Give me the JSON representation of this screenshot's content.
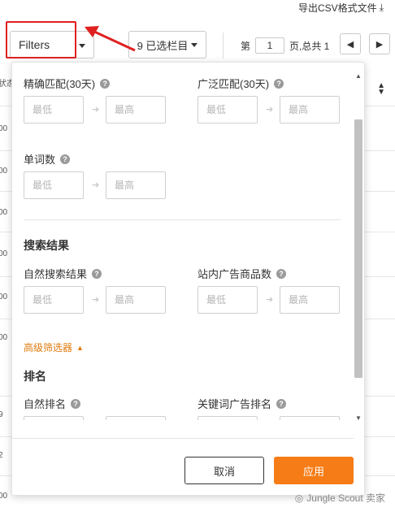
{
  "topbar": {
    "export_label": "导出CSV格式文件"
  },
  "toolbar": {
    "filters_label": "Filters",
    "columns_label": "9 已选栏目",
    "page_prefix": "第",
    "page_value": "1",
    "page_suffix": "页,总共 1"
  },
  "background_rows": [
    "状态",
    "00",
    "00",
    "00",
    "00",
    "00",
    "00",
    "9",
    "2",
    "00"
  ],
  "filters": {
    "exact_match": {
      "label": "精确匹配(30天)",
      "min_placeholder": "最低",
      "max_placeholder": "最高"
    },
    "broad_match": {
      "label": "广泛匹配(30天)",
      "min_placeholder": "最低",
      "max_placeholder": "最高"
    },
    "word_count": {
      "label": "单词数",
      "min_placeholder": "最低",
      "max_placeholder": "最高"
    },
    "search_results_title": "搜索结果",
    "organic_results": {
      "label": "自然搜索结果",
      "min_placeholder": "最低",
      "max_placeholder": "最高"
    },
    "sponsored_products": {
      "label": "站内广告商品数",
      "min_placeholder": "最低",
      "max_placeholder": "最高"
    },
    "advanced_label": "高级筛选器",
    "ranking_title": "排名",
    "organic_rank": {
      "label": "自然排名"
    },
    "sponsored_rank": {
      "label": "关键词广告排名"
    }
  },
  "footer": {
    "cancel_label": "取消",
    "apply_label": "应用"
  },
  "watermark": "Jungle Scout 卖家",
  "colors": {
    "accent": "#f57c16",
    "highlight": "#e02020",
    "advanced_text": "#e07b0f"
  }
}
